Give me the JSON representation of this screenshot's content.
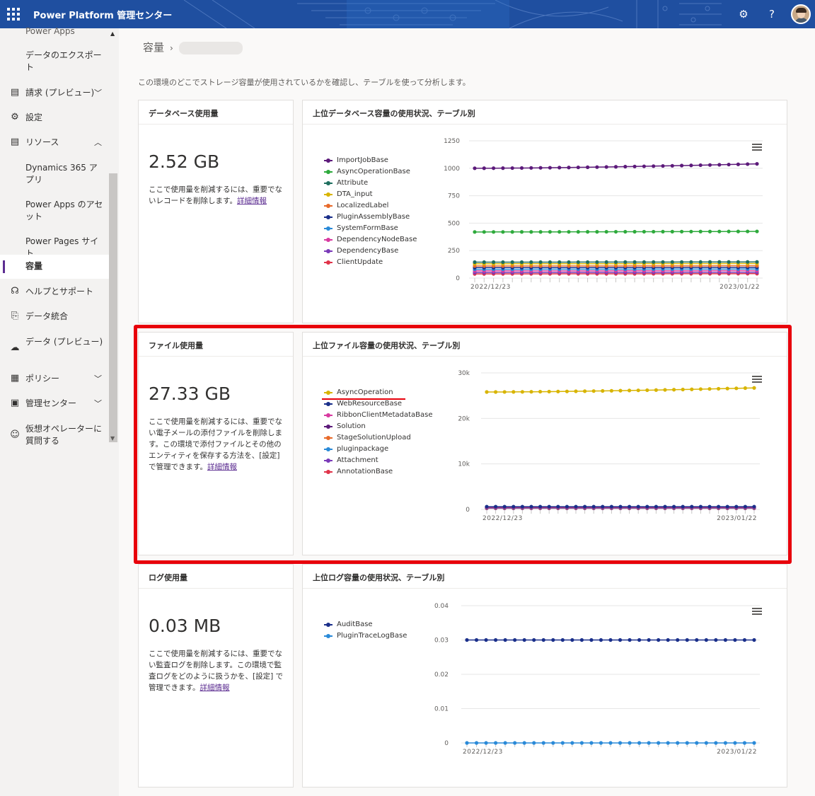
{
  "header": {
    "app_title": "Power Platform 管理センター",
    "icons": [
      "waffle-icon",
      "gear-icon",
      "help-icon",
      "avatar"
    ]
  },
  "sidebar": {
    "items": [
      {
        "label": "Power Apps",
        "icon": "",
        "level": "sub"
      },
      {
        "label": "データのエクスポート",
        "icon": "",
        "level": "sub"
      },
      {
        "label": "請求 (プレビュー)",
        "icon": "billing-icon",
        "chevron": "down"
      },
      {
        "label": "設定",
        "icon": "gear-icon"
      },
      {
        "label": "リソース",
        "icon": "resources-icon",
        "chevron": "up"
      },
      {
        "label": "Dynamics 365 アプリ",
        "icon": "",
        "level": "sub"
      },
      {
        "label": "Power Apps のアセット",
        "icon": "",
        "level": "sub"
      },
      {
        "label": "Power Pages サイト",
        "icon": "",
        "level": "sub"
      },
      {
        "label": "容量",
        "icon": "",
        "level": "sub",
        "active": true
      },
      {
        "label": "ヘルプとサポート",
        "icon": "headset-icon"
      },
      {
        "label": "データ統合",
        "icon": "data-integration-icon"
      },
      {
        "label": "データ (プレビュー)",
        "icon": "cloud-data-icon"
      },
      {
        "label": "ポリシー",
        "icon": "policy-icon",
        "chevron": "down"
      },
      {
        "label": "管理センター",
        "icon": "admin-center-icon",
        "chevron": "down"
      },
      {
        "label": "仮想オペレーターに質問する",
        "icon": "virtual-agent-icon"
      }
    ]
  },
  "breadcrumb": {
    "root": "容量",
    "current": ""
  },
  "intro": "この環境のどこでストレージ容量が使用されているかを確認し、テーブルを使って分析します。",
  "sections": [
    {
      "usage_title": "データベース使用量",
      "usage_value": "2.52 GB",
      "usage_desc": "ここで使用量を削減するには、重要でないレコードを削除します。",
      "link": "詳細情報",
      "chart_title": "上位データベース容量の使用状況、テーブル別"
    },
    {
      "usage_title": "ファイル使用量",
      "usage_value": "27.33 GB",
      "usage_desc": "ここで使用量を削減するには、重要でない電子メールの添付ファイルを削除します。この環境で添付ファイルとその他のエンティティを保存する方法を、[設定] で管理できます。",
      "link": "詳細情報",
      "chart_title": "上位ファイル容量の使用状況、テーブル別"
    },
    {
      "usage_title": "ログ使用量",
      "usage_value": "0.03 MB",
      "usage_desc": "ここで使用量を削減するには、重要でない監査ログを削除します。この環境で監査ログをどのように扱うかを、[設定] で管理できます。",
      "link": "詳細情報",
      "chart_title": "上位ログ容量の使用状況、テーブル別"
    }
  ],
  "chart_data": [
    {
      "type": "line",
      "title": "上位データベース容量の使用状況、テーブル別",
      "x_labels": [
        "2022/12/23",
        "2023/01/22"
      ],
      "y_ticks": [
        "0",
        "250",
        "500",
        "750",
        "1000",
        "1250"
      ],
      "ylim": [
        0,
        1250
      ],
      "points": 31,
      "legend_position": "left",
      "series": [
        {
          "name": "ImportJobBase",
          "color": "#5c1a7a",
          "start": 1000,
          "end": 1040
        },
        {
          "name": "AsyncOperationBase",
          "color": "#2eaa3c",
          "start": 420,
          "end": 425
        },
        {
          "name": "Attribute",
          "color": "#1f6f5f",
          "start": 145,
          "end": 147
        },
        {
          "name": "DTA_input",
          "color": "#d8b400",
          "start": 130,
          "end": 132
        },
        {
          "name": "LocalizedLabel",
          "color": "#e86a2a",
          "start": 110,
          "end": 112
        },
        {
          "name": "PluginAssemblyBase",
          "color": "#1a2f8a",
          "start": 95,
          "end": 97
        },
        {
          "name": "SystemFormBase",
          "color": "#2a8ad8",
          "start": 80,
          "end": 82
        },
        {
          "name": "DependencyNodeBase",
          "color": "#d83aa0",
          "start": 65,
          "end": 67
        },
        {
          "name": "DependencyBase",
          "color": "#7a3ab8",
          "start": 50,
          "end": 52
        },
        {
          "name": "ClientUpdate",
          "color": "#e0344a",
          "start": 38,
          "end": 40
        }
      ]
    },
    {
      "type": "line",
      "title": "上位ファイル容量の使用状況、テーブル別",
      "x_labels": [
        "2022/12/23",
        "2023/01/22"
      ],
      "y_ticks": [
        "0",
        "10k",
        "20k",
        "30k"
      ],
      "ylim": [
        0,
        30000
      ],
      "points": 31,
      "legend_position": "left",
      "series": [
        {
          "name": "AsyncOperation",
          "color": "#d8b400",
          "start": 25800,
          "end": 26700
        },
        {
          "name": "WebResourceBase",
          "color": "#1a2f8a",
          "start": 600,
          "end": 600
        },
        {
          "name": "RibbonClientMetadataBase",
          "color": "#d83aa0",
          "start": 500,
          "end": 500
        },
        {
          "name": "Solution",
          "color": "#5c1a7a",
          "start": 450,
          "end": 450
        },
        {
          "name": "StageSolutionUpload",
          "color": "#e86a2a",
          "start": 400,
          "end": 400
        },
        {
          "name": "pluginpackage",
          "color": "#2a8ad8",
          "start": 350,
          "end": 350
        },
        {
          "name": "Attachment",
          "color": "#7a3ab8",
          "start": 300,
          "end": 300
        },
        {
          "name": "AnnotationBase",
          "color": "#e0344a",
          "start": 250,
          "end": 250
        }
      ]
    },
    {
      "type": "line",
      "title": "上位ログ容量の使用状況、テーブル別",
      "x_labels": [
        "2022/12/23",
        "2023/01/22"
      ],
      "y_ticks": [
        "0",
        "0.01",
        "0.02",
        "0.03",
        "0.04"
      ],
      "ylim": [
        0,
        0.04
      ],
      "points": 31,
      "legend_position": "left",
      "series": [
        {
          "name": "AuditBase",
          "color": "#1a2f8a",
          "start": 0.03,
          "end": 0.03
        },
        {
          "name": "PluginTraceLogBase",
          "color": "#2a8ad8",
          "start": 0.0,
          "end": 0.0
        }
      ]
    }
  ]
}
